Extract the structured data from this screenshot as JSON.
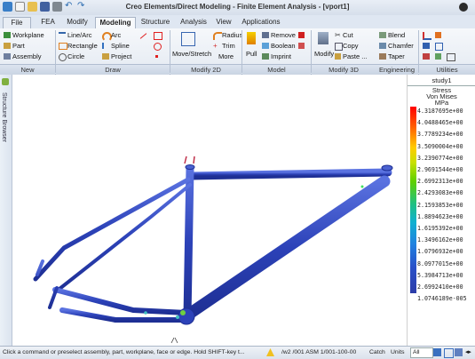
{
  "window": {
    "title": "Creo Elements/Direct Modeling - Finite Element Analysis - [vport1]"
  },
  "tabs": [
    "File",
    "FEA",
    "Modify",
    "Modeling",
    "Structure",
    "Analysis",
    "View",
    "Applications"
  ],
  "active_tab": "Modeling",
  "ribbon": {
    "new": {
      "workplane": "Workplane",
      "part": "Part",
      "assembly": "Assembly",
      "group": "New"
    },
    "draw": {
      "line_arc": "Line/Arc",
      "arc": "Arc",
      "rectangle": "Rectangle",
      "spline": "Spline",
      "circle": "Circle",
      "project": "Project",
      "group": "Draw"
    },
    "modify2d": {
      "move_stretch": "Move/Stretch",
      "radius": "Radius",
      "trim": "Trim",
      "more": "More",
      "group": "Modify 2D"
    },
    "model": {
      "pull": "Pull",
      "remove": "Remove",
      "boolean": "Boolean",
      "imprint": "Imprint",
      "group": "Model"
    },
    "modify3d": {
      "modify": "Modify",
      "cut": "Cut",
      "copy": "Copy",
      "paste": "Paste ...",
      "blend": "Blend",
      "chamfer": "Chamfer",
      "taper": "Taper",
      "group": "Modify 3D"
    },
    "engineering": {
      "group": "Engineering"
    },
    "utilities": {
      "group": "Utilities"
    }
  },
  "sidebar": {
    "label": "Structure Browser"
  },
  "legend": {
    "study": "study1",
    "title_lines": [
      "Stress",
      "Von Mises",
      "MPa"
    ],
    "values": [
      "4.3187695e+00",
      "4.0488465e+00",
      "3.7789234e+00",
      "3.5090004e+00",
      "3.2390774e+00",
      "2.9691544e+00",
      "2.6992313e+00",
      "2.4293083e+00",
      "2.1593853e+00",
      "1.8894623e+00",
      "1.6195392e+00",
      "1.3496162e+00",
      "1.0796932e+00",
      "8.0977015e+00",
      "5.3984713e+00",
      "2.6992410e+00",
      "1.0746189e-005"
    ]
  },
  "status": {
    "message": "Click a command or preselect assembly, part, workplane, face or edge. Hold SHIFT-key t...",
    "path": "/w2 /001 ASM 1/001-100-00",
    "catch": "Catch",
    "units": "Units",
    "units_value": "All"
  },
  "colors": {
    "frame": "#2d43b8",
    "accent": "#1f5fb0"
  }
}
